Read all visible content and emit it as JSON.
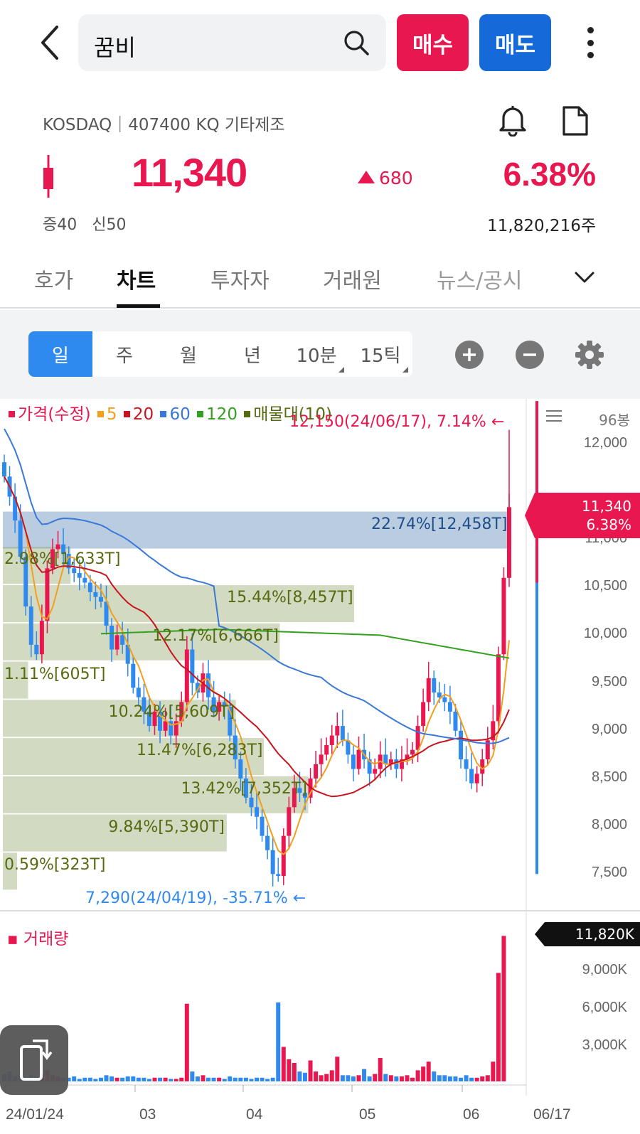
{
  "search": {
    "query": "꿈비"
  },
  "actions": {
    "buy_label": "매수",
    "sell_label": "매도"
  },
  "stock": {
    "market_info": "KOSDAQ｜407400 KQ 기타제조",
    "price": "11,340",
    "change": "680",
    "change_pct": "6.38%",
    "margin_info": "증40   신50",
    "volume": "11,820,216주"
  },
  "tabs": [
    {
      "label": "호가"
    },
    {
      "label": "차트"
    },
    {
      "label": "투자자"
    },
    {
      "label": "거래원"
    },
    {
      "label": "뉴스/공시"
    }
  ],
  "periods": [
    {
      "label": "일"
    },
    {
      "label": "주"
    },
    {
      "label": "월"
    },
    {
      "label": "년"
    },
    {
      "label": "10분"
    },
    {
      "label": "15틱"
    }
  ],
  "colors": {
    "up": "#e8174f",
    "down": "#2f8af0",
    "ma5": "#f0a020",
    "ma20": "#c8141e",
    "ma60": "#3a78d8",
    "ma120": "#34a020",
    "vp": "#556b0f"
  },
  "icons": [
    "back-icon",
    "search-icon",
    "more-icon",
    "bell-icon",
    "document-icon",
    "chevron-down-icon",
    "zoom-in-icon",
    "zoom-out-icon",
    "gear-icon",
    "rotate-icon"
  ],
  "chart_data": {
    "type": "candlestick",
    "legend": {
      "price": "가격(수정)",
      "ma5": "5",
      "ma20": "20",
      "ma60": "60",
      "ma120": "120",
      "vp": "매물대(10)"
    },
    "candle_count": "96봉",
    "y_ticks": [
      "12,000",
      "11,000",
      "10,500",
      "10,000",
      "9,500",
      "9,000",
      "8,500",
      "8,000",
      "7,500"
    ],
    "price_tag": {
      "price": "11,340",
      "pct": "6.38%"
    },
    "high_annotation": "12,150(24/06/17), 7.14% ←",
    "low_annotation": "7,290(24/04/19), -35.71% ←",
    "volume_profile": [
      {
        "label": "22.74%[12,458T]",
        "price": 11100,
        "pct": 22.74
      },
      {
        "label": "2.98%[1,633T]",
        "price": 10730,
        "pct": 2.98
      },
      {
        "label": "15.44%[8,457T]",
        "price": 10330,
        "pct": 15.44
      },
      {
        "label": "12.17%[6,666T]",
        "price": 9930,
        "pct": 12.17
      },
      {
        "label": "1.11%[605T]",
        "price": 9530,
        "pct": 1.11
      },
      {
        "label": "10.24%[5,609T]",
        "price": 9130,
        "pct": 10.24
      },
      {
        "label": "11.47%[6,283T]",
        "price": 8730,
        "pct": 11.47
      },
      {
        "label": "13.42%[7,352T]",
        "price": 8330,
        "pct": 13.42
      },
      {
        "label": "9.84%[5,390T]",
        "price": 7930,
        "pct": 9.84
      },
      {
        "label": "0.59%[323T]",
        "price": 7530,
        "pct": 0.59
      }
    ],
    "closes": [
      11660,
      11450,
      11200,
      10820,
      10300,
      9900,
      9800,
      10150,
      10700,
      10900,
      10950,
      10850,
      10700,
      10650,
      10600,
      10550,
      10450,
      10400,
      10350,
      10100,
      9850,
      10000,
      9900,
      9700,
      9450,
      9350,
      9200,
      9050,
      9200,
      9000,
      9100,
      8950,
      9100,
      9300,
      9850,
      9500,
      9400,
      9600,
      9350,
      9200,
      9300,
      9250,
      8950,
      8700,
      8500,
      8300,
      8200,
      8100,
      7900,
      7750,
      7500,
      7480,
      7900,
      8200,
      8400,
      8350,
      8300,
      8500,
      8650,
      8750,
      8850,
      8950,
      9050,
      8900,
      8750,
      8600,
      8800,
      8700,
      8550,
      8600,
      8750,
      8650,
      8700,
      8600,
      8700,
      8750,
      8800,
      9050,
      9300,
      9550,
      9400,
      9350,
      9300,
      9200,
      9000,
      8700,
      8600,
      8450,
      8550,
      8700,
      8900,
      9100,
      9800,
      10600,
      11340
    ],
    "volume_ticks": [
      "9,000K",
      "6,000K",
      "3,000K"
    ],
    "volume_tag": "11,820K",
    "volume_legend": "거래량",
    "x_ticks": [
      "24/01/24",
      "03",
      "04",
      "05",
      "06",
      "06/17"
    ]
  }
}
